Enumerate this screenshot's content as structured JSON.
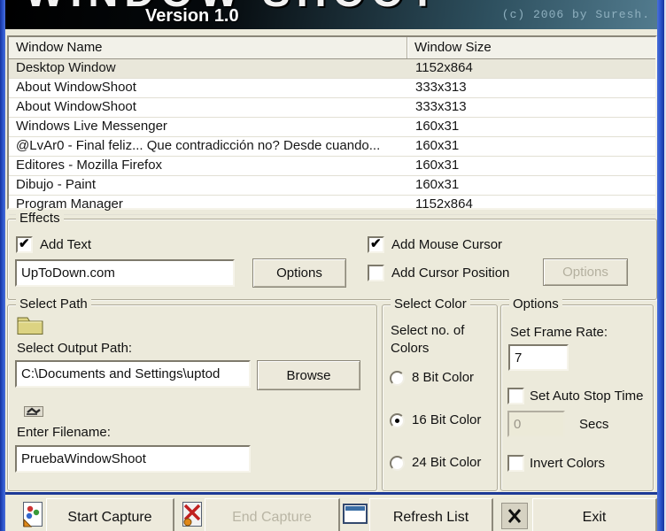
{
  "banner": {
    "logo_text": "WINDOW SHOOT",
    "version": "Version 1.0",
    "copyright": "(c) 2006 by Suresh."
  },
  "window_list": {
    "columns": [
      "Window Name",
      "Window Size"
    ],
    "rows": [
      {
        "name": "Desktop Window",
        "size": "1152x864"
      },
      {
        "name": "About WindowShoot",
        "size": "333x313"
      },
      {
        "name": "About WindowShoot",
        "size": "333x313"
      },
      {
        "name": "Windows Live Messenger",
        "size": "160x31"
      },
      {
        "name": "@LvAr0 - Final feliz... Que contradicción no? Desde cuando...",
        "size": "160x31"
      },
      {
        "name": "Editores - Mozilla Firefox",
        "size": "160x31"
      },
      {
        "name": "Dibujo - Paint",
        "size": "160x31"
      },
      {
        "name": "Program Manager",
        "size": "1152x864"
      }
    ]
  },
  "effects": {
    "title": "Effects",
    "add_text": {
      "label": "Add Text",
      "checked": true
    },
    "text_value": "UpToDown.com",
    "options_button": "Options",
    "add_mouse_cursor": {
      "label": "Add Mouse Cursor",
      "checked": true
    },
    "add_cursor_position": {
      "label": "Add Cursor Position",
      "checked": false
    },
    "cursor_options_button": "Options"
  },
  "select_path": {
    "title": "Select Path",
    "output_label": "Select Output Path:",
    "output_value": "C:\\Documents and Settings\\uptod",
    "browse_button": "Browse",
    "filename_label": "Enter Filename:",
    "filename_value": "PruebaWindowShoot"
  },
  "select_color": {
    "title": "Select Color",
    "subtitle_line1": "Select no. of",
    "subtitle_line2": "Colors",
    "options": [
      {
        "label": "8 Bit Color",
        "selected": false
      },
      {
        "label": "16 Bit Color",
        "selected": true
      },
      {
        "label": "24 Bit Color",
        "selected": false
      }
    ]
  },
  "options": {
    "title": "Options",
    "frame_rate_label": "Set Frame Rate:",
    "frame_rate_value": "7",
    "auto_stop": {
      "label": "Set Auto Stop Time",
      "checked": false
    },
    "secs_value": "0",
    "secs_label": "Secs",
    "invert": {
      "label": "Invert Colors",
      "checked": false
    }
  },
  "toolbar": {
    "start_button": "Start Capture",
    "end_button": "End Capture",
    "refresh_button": "Refresh List",
    "exit_button": "Exit"
  },
  "colors": {
    "dialog_bg": "#eceadb",
    "window_border_blue": "#2c55cc",
    "banner_right": "#527b8e",
    "copyright_text": "#8fb0bf",
    "selected_row_bg": "#e9e7da",
    "disabled_text": "#b4b09f"
  }
}
